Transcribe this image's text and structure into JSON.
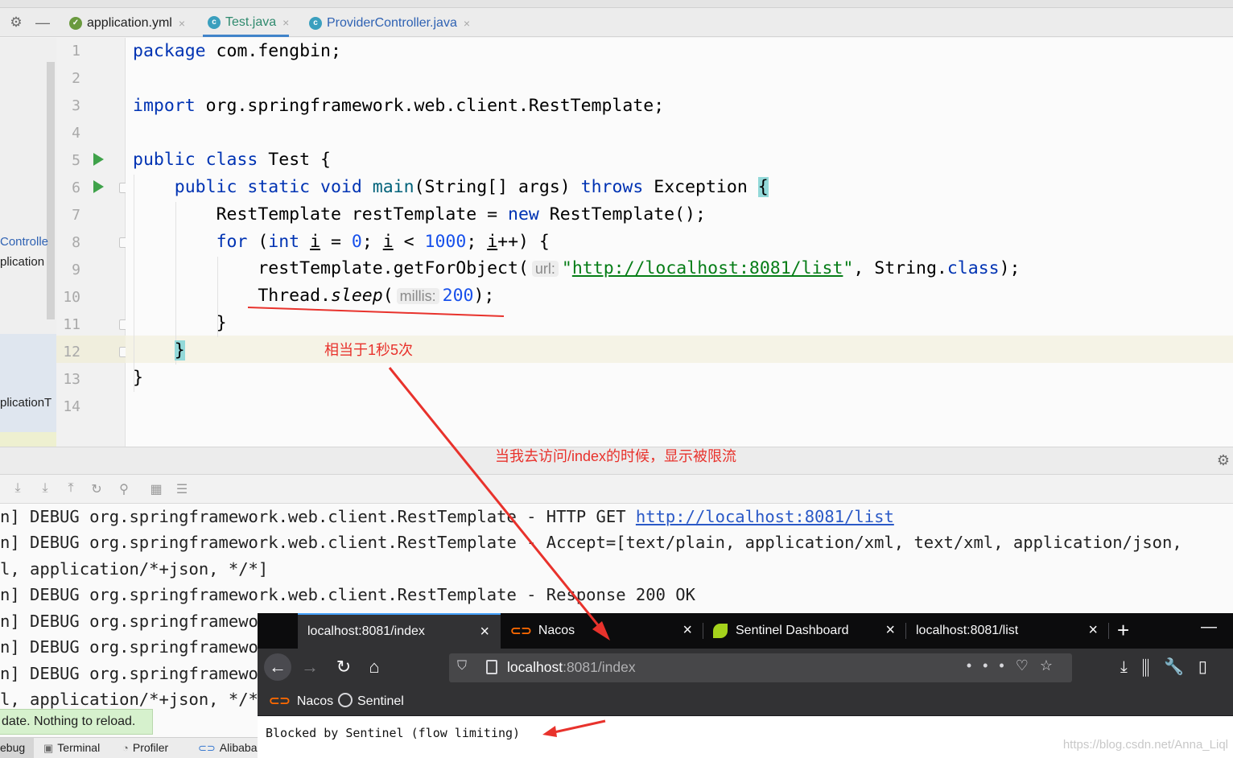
{
  "ide": {
    "tabs": [
      {
        "label": "application.yml",
        "icon": "yaml-file-icon",
        "active": false
      },
      {
        "label": "Test.java",
        "icon": "java-class-icon",
        "active": true
      },
      {
        "label": "ProviderController.java",
        "icon": "java-class-icon",
        "active": false
      }
    ],
    "project_fragments": [
      "Controlle",
      "plication",
      "plicationT"
    ],
    "line_numbers": [
      "1",
      "2",
      "3",
      "4",
      "5",
      "6",
      "7",
      "8",
      "9",
      "10",
      "11",
      "12",
      "13",
      "14"
    ],
    "code": {
      "l1_kw": "package",
      "l1_rest": " com.fengbin;",
      "l3_kw": "import",
      "l3_rest": " org.springframework.web.client.RestTemplate;",
      "l5_kw1": "public",
      "l5_kw2": "class",
      "l5_rest": " Test {",
      "l6_kw1": "public",
      "l6_kw2": "static",
      "l6_kw3": "void",
      "l6_name": "main",
      "l6_mid": "(String[] args) ",
      "l6_kw4": "throws",
      "l6_rest": " Exception ",
      "l6_brace": "{",
      "l7_a": "RestTemplate restTemplate = ",
      "l7_kw": "new",
      "l7_b": " RestTemplate();",
      "l8_kw": "for",
      "l8_a": " (",
      "l8_kw2": "int",
      "l8_b": " ",
      "l8_i1": "i",
      "l8_c": " = ",
      "l8_n0": "0",
      "l8_d": "; ",
      "l8_i2": "i",
      "l8_e": " < ",
      "l8_n1000": "1000",
      "l8_f": "; ",
      "l8_i3": "i",
      "l8_g": "++) {",
      "l9_a": "restTemplate.getForObject(",
      "l9_hint": "url:",
      "l9_q1": "\"",
      "l9_url": "http://localhost:8081/list",
      "l9_q2": "\"",
      "l9_b": ", String.",
      "l9_kw": "class",
      "l9_c": ");",
      "l10_a": "Thread.",
      "l10_sleep": "sleep",
      "l10_b": "(",
      "l10_hint": "millis:",
      "l10_num": "200",
      "l10_c": ");",
      "l11": "}",
      "l12_brace": "}",
      "l13": "}"
    }
  },
  "annotations": {
    "rate_note": "相当于1秒5次",
    "index_note": "当我去访问/index的时候，显示被限流"
  },
  "console": {
    "lines": [
      {
        "text": "n] DEBUG org.springframework.web.client.RestTemplate - HTTP GET ",
        "link": "http://localhost:8081/list"
      },
      {
        "text": "n] DEBUG org.springframework.web.client.RestTemplate - Accept=[text/plain, application/xml, text/xml, application/json,",
        "link": ""
      },
      {
        "text": "l, application/*+json, */*]",
        "link": ""
      },
      {
        "text": "n] DEBUG org.springframework.web.client.RestTemplate - Response 200 OK",
        "link": ""
      },
      {
        "text": "n] DEBUG org.springframewor",
        "link": ""
      },
      {
        "text": "n] DEBUG org.springframewor",
        "link": ""
      },
      {
        "text": "n] DEBUG org.springframewor",
        "link": ""
      },
      {
        "text": "l, application/*+json, */*]",
        "link": ""
      }
    ],
    "notice": "date. Nothing to reload."
  },
  "bottom_bar": {
    "items": [
      {
        "label": "ebug",
        "icon": ""
      },
      {
        "label": "Terminal",
        "icon": "terminal-icon"
      },
      {
        "label": "Profiler",
        "icon": "profiler-icon"
      },
      {
        "label": "Alibaba",
        "icon": "alibaba-icon"
      }
    ]
  },
  "browser": {
    "tabs": [
      {
        "label": "localhost:8081/index",
        "active": true,
        "icon": ""
      },
      {
        "label": "Nacos",
        "active": false,
        "icon": "nacos-icon"
      },
      {
        "label": "Sentinel Dashboard",
        "active": false,
        "icon": "spring-leaf-icon"
      },
      {
        "label": "localhost:8081/list",
        "active": false,
        "icon": ""
      }
    ],
    "close_glyph": "×",
    "new_tab_glyph": "+",
    "url_host": "localhost",
    "url_path": ":8081/index",
    "bookmarks": [
      {
        "label": "Nacos",
        "icon": "nacos-icon"
      },
      {
        "label": "Sentinel",
        "icon": "globe-icon"
      }
    ],
    "page_text": "Blocked by Sentinel (flow limiting)",
    "watermark": "https://blog.csdn.net/Anna_Liql"
  },
  "colors": {
    "keyword": "#0033b3",
    "number": "#1750eb",
    "string": "#067d17",
    "annotation_red": "#e8322c",
    "firefox_dark": "#0c0c0d",
    "firefox_toolbar": "#323234",
    "firefox_accent": "#45a1ff"
  }
}
